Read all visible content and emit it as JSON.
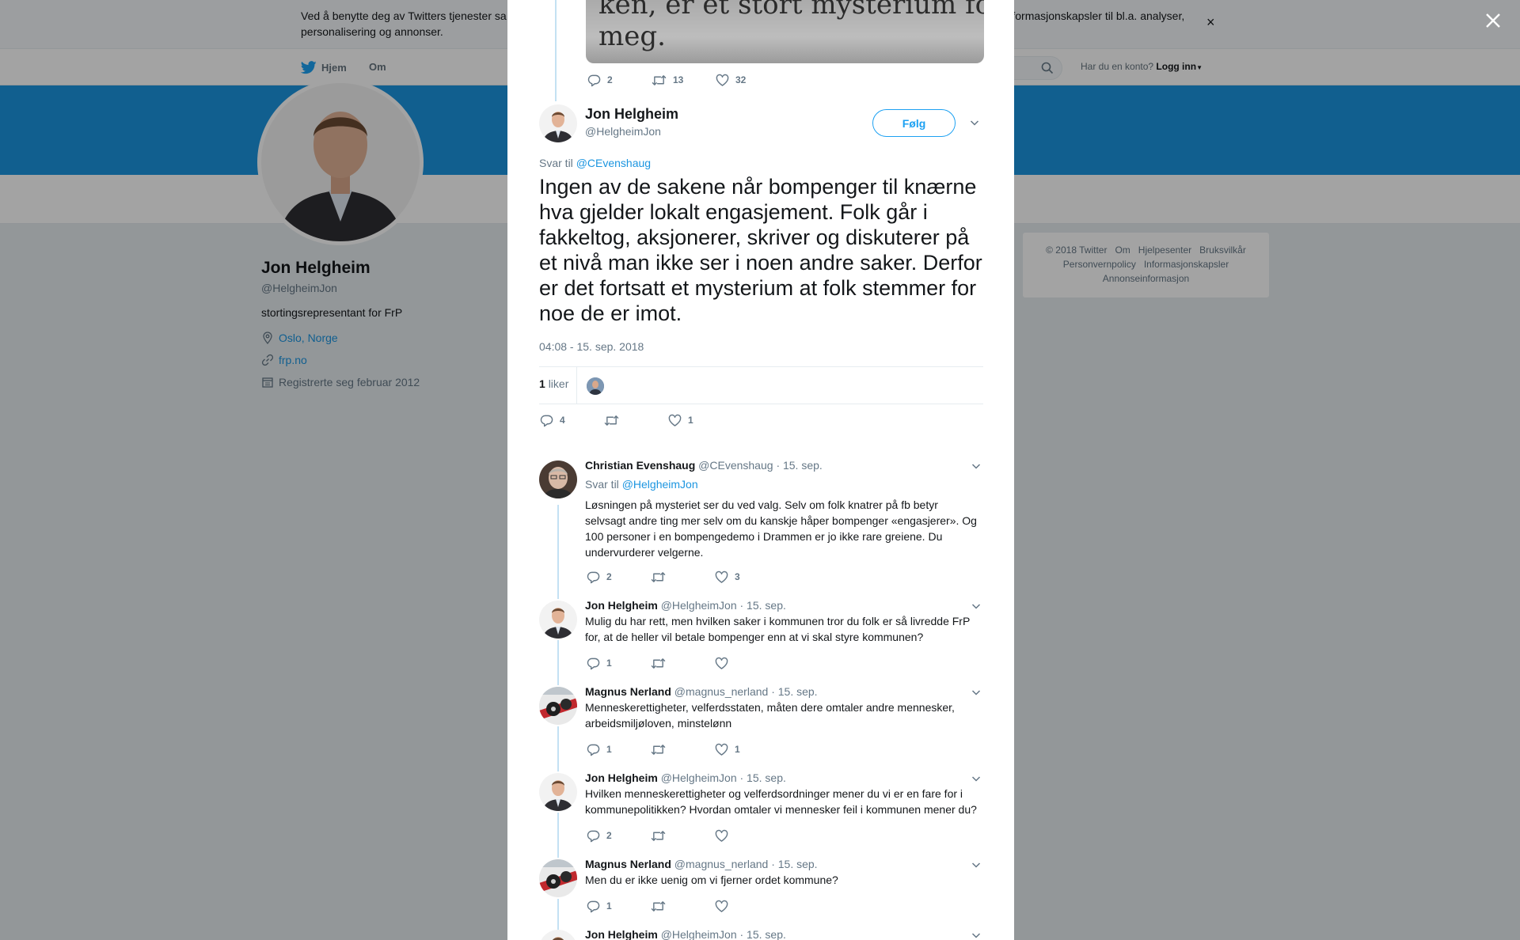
{
  "cookie_bar": {
    "text_start": "Ved å benytte deg av Twitters tjenester sa",
    "text_end": "informasjonskapsler til bl.a. analyser,",
    "text_line2": "personalisering og annonser.",
    "close": "×"
  },
  "nav": {
    "home": "Hjem",
    "about": "Om",
    "login_prompt": "Har du en konto?",
    "login": "Logg inn"
  },
  "profile": {
    "name": "Jon Helgheim",
    "handle": "@HelgheimJon",
    "bio": "stortingsrepresentant for FrP",
    "location": "Oslo, Norge",
    "website": "frp.no",
    "joined": "Registrerte seg februar 2012"
  },
  "footer": {
    "line1": [
      "© 2018 Twitter",
      "Om",
      "Hjelpesenter",
      "Bruksvilkår"
    ],
    "line2": [
      "Personvernpolicy",
      "Informasjonskapsler"
    ],
    "line3": [
      "Annonseinformasjon"
    ]
  },
  "previous_tweet": {
    "image_text_line1": "ken, er et stort mysterium for",
    "image_text_line2": "meg.",
    "replies": "2",
    "retweets": "13",
    "likes": "32"
  },
  "main_tweet": {
    "name": "Jon Helgheim",
    "handle": "@HelgheimJon",
    "follow_label": "Følg",
    "reply_to_label": "Svar til",
    "reply_to_handle": "@CEvenshaug",
    "text": "Ingen av de sakene når bompenger til knærne hva gjelder lokalt engasjement. Folk går i fakkeltog, aksjonerer, skriver og diskuterer på et nivå man ikke ser i noen andre saker. Derfor er det fortsatt et mysterium at folk stemmer for noe de er imot.",
    "timestamp": "04:08 - 15. sep. 2018",
    "likes_count": "1",
    "likes_label": "liker",
    "replies": "4",
    "retweets": "",
    "likes": "1"
  },
  "replies": [
    {
      "name": "Christian Evenshaug",
      "handle": "@CEvenshaug",
      "date": "· 15. sep.",
      "reply_to_label": "Svar til",
      "reply_to_handle": "@HelgheimJon",
      "text": "Løsningen på mysteriet ser du ved valg. Selv om folk knatrer på fb betyr selvsagt andre ting mer selv om du kanskje håper bompenger «engasjerer». Og 100 personer i en bompengedemo i Drammen er jo ikke rare greiene. Du undervurderer velgerne.",
      "replies": "2",
      "retweets": "",
      "likes": "3"
    },
    {
      "name": "Jon Helgheim",
      "handle": "@HelgheimJon",
      "date": "· 15. sep.",
      "text": "Mulig du har rett, men hvilken saker i kommunen tror du folk er så livredde FrP for, at de heller vil betale bompenger enn at vi skal styre kommunen?",
      "replies": "1",
      "retweets": "",
      "likes": ""
    },
    {
      "name": "Magnus Nerland",
      "handle": "@magnus_nerland",
      "date": "· 15. sep.",
      "text": "Menneskerettigheter, velferdsstaten, måten dere omtaler andre mennesker, arbeidsmiljøloven, minstelønn",
      "replies": "1",
      "retweets": "",
      "likes": "1"
    },
    {
      "name": "Jon Helgheim",
      "handle": "@HelgheimJon",
      "date": "· 15. sep.",
      "text": "Hvilken menneskerettigheter og velferdsordninger mener du vi er en fare for i kommunepolitikken? Hvordan omtaler vi mennesker feil i kommunen mener du?",
      "replies": "2",
      "retweets": "",
      "likes": ""
    },
    {
      "name": "Magnus Nerland",
      "handle": "@magnus_nerland",
      "date": "· 15. sep.",
      "text": "Men du er ikke uenig om vi fjerner ordet kommune?",
      "replies": "1",
      "retweets": "",
      "likes": ""
    },
    {
      "name": "Jon Helgheim",
      "handle": "@HelgheimJon",
      "date": "· 15. sep."
    }
  ],
  "colors": {
    "brand_blue": "#1da1f2",
    "cover_blue": "#1b95e0",
    "thread_line": "#c4e1f3",
    "muted": "#657786"
  },
  "icons": [
    "twitter-bird-icon",
    "search-icon",
    "close-icon",
    "reply-icon",
    "retweet-icon",
    "heart-icon",
    "chevron-down-icon",
    "location-icon",
    "link-icon",
    "calendar-icon"
  ]
}
